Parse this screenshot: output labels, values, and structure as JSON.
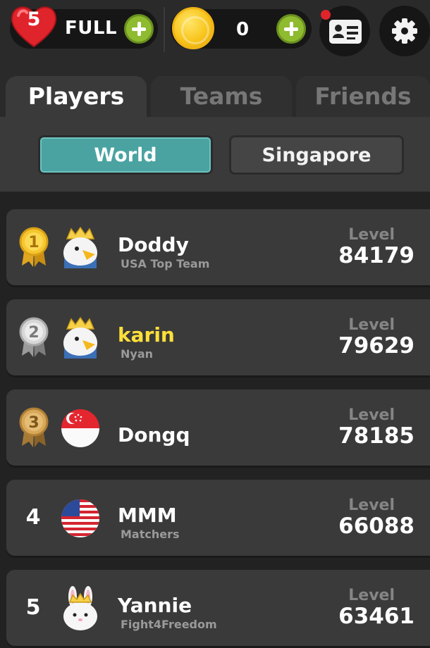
{
  "status_bar": {
    "lives_count": "5",
    "lives_status": "FULL",
    "coins": "0",
    "has_notification": true,
    "icons": [
      "heart-icon",
      "plus-icon",
      "coin-icon",
      "profile-card-icon",
      "gear-icon"
    ],
    "colors": {
      "heart": "#e0242c",
      "plus": "#8ebb2f",
      "coin": "#f8c51c"
    }
  },
  "tabs": [
    {
      "label": "Players",
      "active": true
    },
    {
      "label": "Teams",
      "active": false
    },
    {
      "label": "Friends",
      "active": false
    }
  ],
  "region_filter": {
    "world_label": "World",
    "local_label": "Singapore",
    "selected": "World",
    "accent": "#4aa3a1"
  },
  "leaderboard": {
    "level_label": "Level",
    "rows": [
      {
        "rank": "1",
        "name": "Doddy",
        "team": "USA Top Team",
        "level": "84179",
        "avatar": "crowned-eagle-avatar",
        "medal": "gold"
      },
      {
        "rank": "2",
        "name": "karin",
        "team": "Nyan",
        "level": "79629",
        "avatar": "crowned-eagle-avatar",
        "medal": "silver",
        "name_color": "#ffe03a"
      },
      {
        "rank": "3",
        "name": "Dongq",
        "team": "",
        "level": "78185",
        "avatar": "singapore-flag-avatar",
        "medal": "bronze"
      },
      {
        "rank": "4",
        "name": "MMM",
        "team": "Matchers",
        "level": "66088",
        "avatar": "usa-flag-avatar"
      },
      {
        "rank": "5",
        "name": "Yannie",
        "team": "Fight4Freedom",
        "level": "63461",
        "avatar": "crowned-rabbit-avatar"
      }
    ]
  }
}
